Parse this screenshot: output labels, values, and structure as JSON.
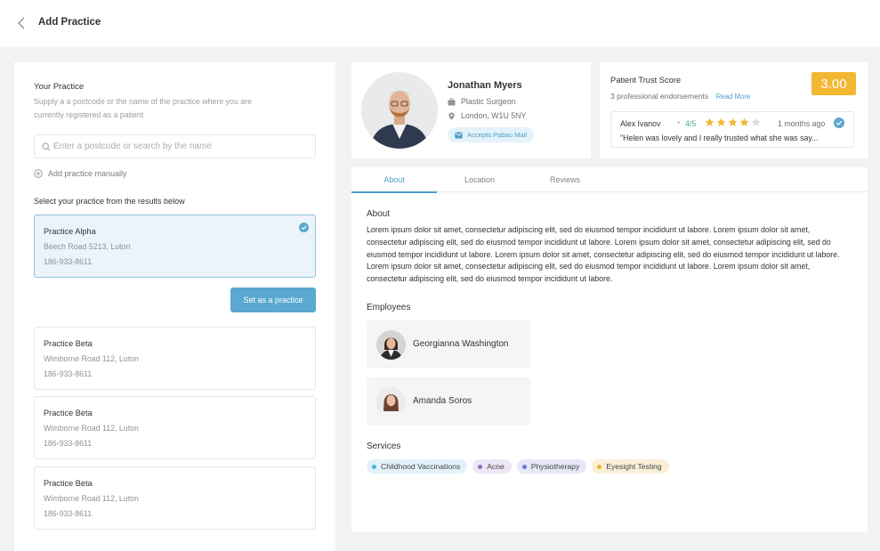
{
  "header": {
    "title": "Add Practice"
  },
  "left": {
    "title": "Your Practice",
    "subtitle": "Supply a a postcode or the name of the practice where you are currently registered as a patient",
    "search_placeholder": "Enter a postcode or search by the name",
    "add_manual_label": "Add practice manually",
    "select_label": "Select your practice from the results below",
    "set_button": "Set as a practice",
    "practices": [
      {
        "name": "Practice Alpha",
        "address": "Beech Road 5213, Luton",
        "phone": "186-933-8611",
        "selected": true
      },
      {
        "name": "Practice Beta",
        "address": "Wimborne Road 112, Luton",
        "phone": "186-933-8611",
        "selected": false
      },
      {
        "name": "Practice Beta",
        "address": "Wimborne Road 112, Luton",
        "phone": "186-933-8611",
        "selected": false
      },
      {
        "name": "Practice Beta",
        "address": "Wimborne Road 112, Luton",
        "phone": "186-933-8611",
        "selected": false
      }
    ]
  },
  "profile": {
    "name": "Jonathan Myers",
    "role": "Plastic Surgeon",
    "location": "London, W1U 5NY",
    "mail_badge": "Accepts Pabau Mail"
  },
  "trust": {
    "title": "Patient Trust Score",
    "endorsements": "3 professional endorsements",
    "read_more": "Read More",
    "score": "3.00",
    "review": {
      "author": "Alex Ivanov",
      "rating": "4/5",
      "stars_filled": 4,
      "stars_total": 5,
      "time": "1 months ago",
      "text": "\"Helen was lovely and I really trusted what she was say..."
    }
  },
  "tabs": [
    {
      "label": "About",
      "active": true
    },
    {
      "label": "Location",
      "active": false
    },
    {
      "label": "Reviews",
      "active": false
    }
  ],
  "about": {
    "title": "About",
    "text": "Lorem ipsum dolor sit amet, consectetur adipiscing elit, sed do eiusmod tempor incididunt ut labore. Lorem ipsum dolor sit amet, consectetur adipiscing elit, sed do eiusmod tempor incididunt ut labore. Lorem ipsum dolor sit amet, consectetur adipiscing elit, sed do eiusmod tempor incididunt ut labore. Lorem ipsum dolor sit amet, consectetur adipiscing elit, sed do eiusmod tempor incididunt ut labore. Lorem ipsum dolor sit amet, consectetur adipiscing elit, sed do eiusmod tempor incididunt ut labore. Lorem ipsum dolor sit amet, consectetur adipiscing elit, sed do eiusmod tempor incididunt ut labore."
  },
  "employees": {
    "title": "Employees",
    "items": [
      {
        "name": "Georgianna Washington"
      },
      {
        "name": "Amanda Soros"
      }
    ]
  },
  "services": {
    "title": "Services",
    "items": [
      {
        "label": "Childhood Vaccinations",
        "bg": "#e3f2fa",
        "dot": "#4fb3dd"
      },
      {
        "label": "Acne",
        "bg": "#ece6f6",
        "dot": "#8e6cc9"
      },
      {
        "label": "Physiotherapy",
        "bg": "#e7e8f7",
        "dot": "#6f74d6"
      },
      {
        "label": "Eyesight Testing",
        "bg": "#fbf0d7",
        "dot": "#f0b22f"
      }
    ]
  },
  "colors": {
    "accent": "#5ba8d0",
    "score": "#f3b832",
    "rating": "#49b08a"
  }
}
